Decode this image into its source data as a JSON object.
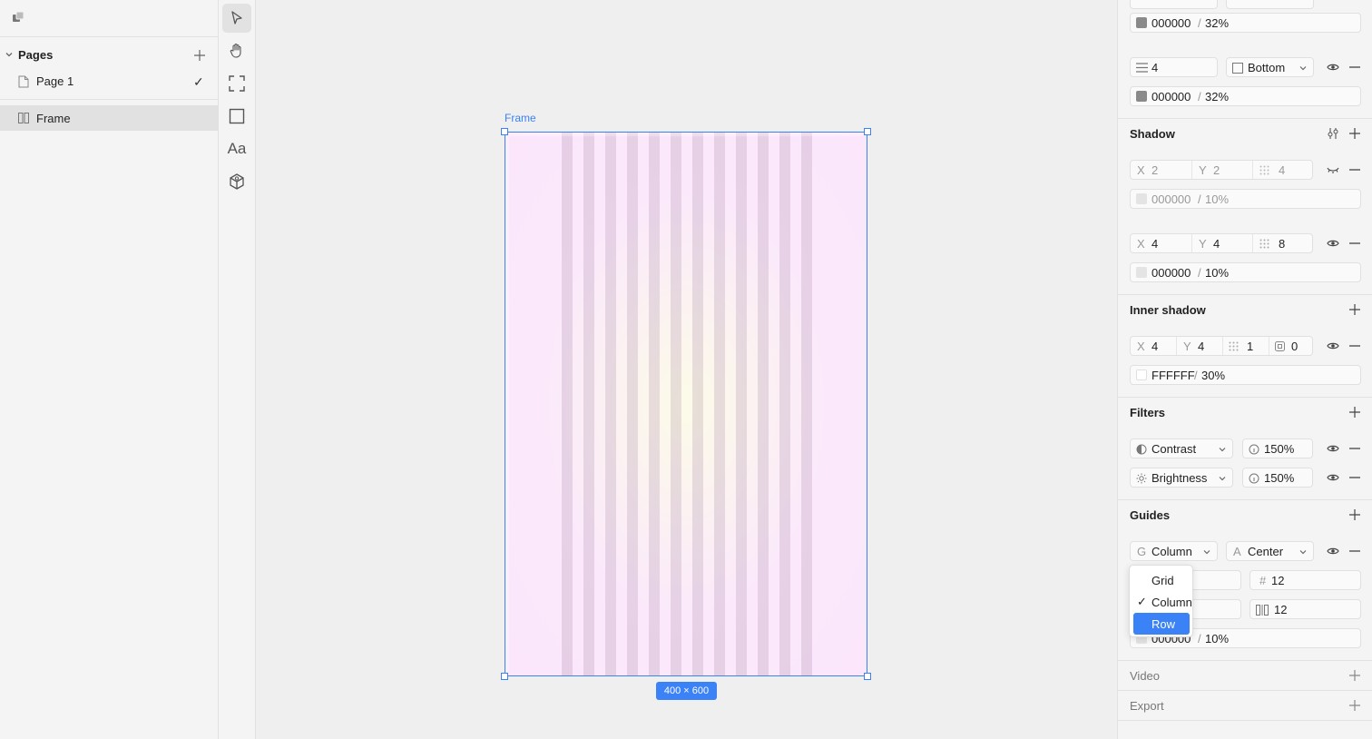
{
  "left_panel": {
    "pages_label": "Pages",
    "page_item": "Page 1",
    "layer_item": "Frame"
  },
  "canvas": {
    "frame_label": "Frame",
    "dimensions": "400 × 600"
  },
  "right_panel": {
    "stroke_top_color": "000000",
    "stroke_top_opacity": "32%",
    "stroke_weight": "4",
    "stroke_position": "Bottom",
    "stroke_color": "000000",
    "stroke_opacity": "32%",
    "shadow": {
      "title": "Shadow",
      "items": [
        {
          "x": "2",
          "y": "2",
          "blur": "4",
          "color": "000000",
          "opacity": "10%"
        },
        {
          "x": "4",
          "y": "4",
          "blur": "8",
          "color": "000000",
          "opacity": "10%"
        }
      ]
    },
    "inner_shadow": {
      "title": "Inner shadow",
      "x": "4",
      "y": "4",
      "blur": "1",
      "spread": "0",
      "color": "FFFFFF",
      "opacity": "30%"
    },
    "filters": {
      "title": "Filters",
      "items": [
        {
          "name": "Contrast",
          "value": "150%"
        },
        {
          "name": "Brightness",
          "value": "150%"
        }
      ]
    },
    "guides": {
      "title": "Guides",
      "type_prefix": "G",
      "type": "Column",
      "align_prefix": "A",
      "align": "Center",
      "count_prefix": "#",
      "count": "12",
      "gutter": "12",
      "color": "000000",
      "opacity": "10%"
    },
    "menu": {
      "options": [
        "Grid",
        "Column",
        "Row"
      ],
      "checked": "Column",
      "highlighted": "Row"
    },
    "video_title": "Video",
    "export_title": "Export",
    "labels": {
      "x": "X",
      "y": "Y",
      "slash": "/"
    }
  }
}
